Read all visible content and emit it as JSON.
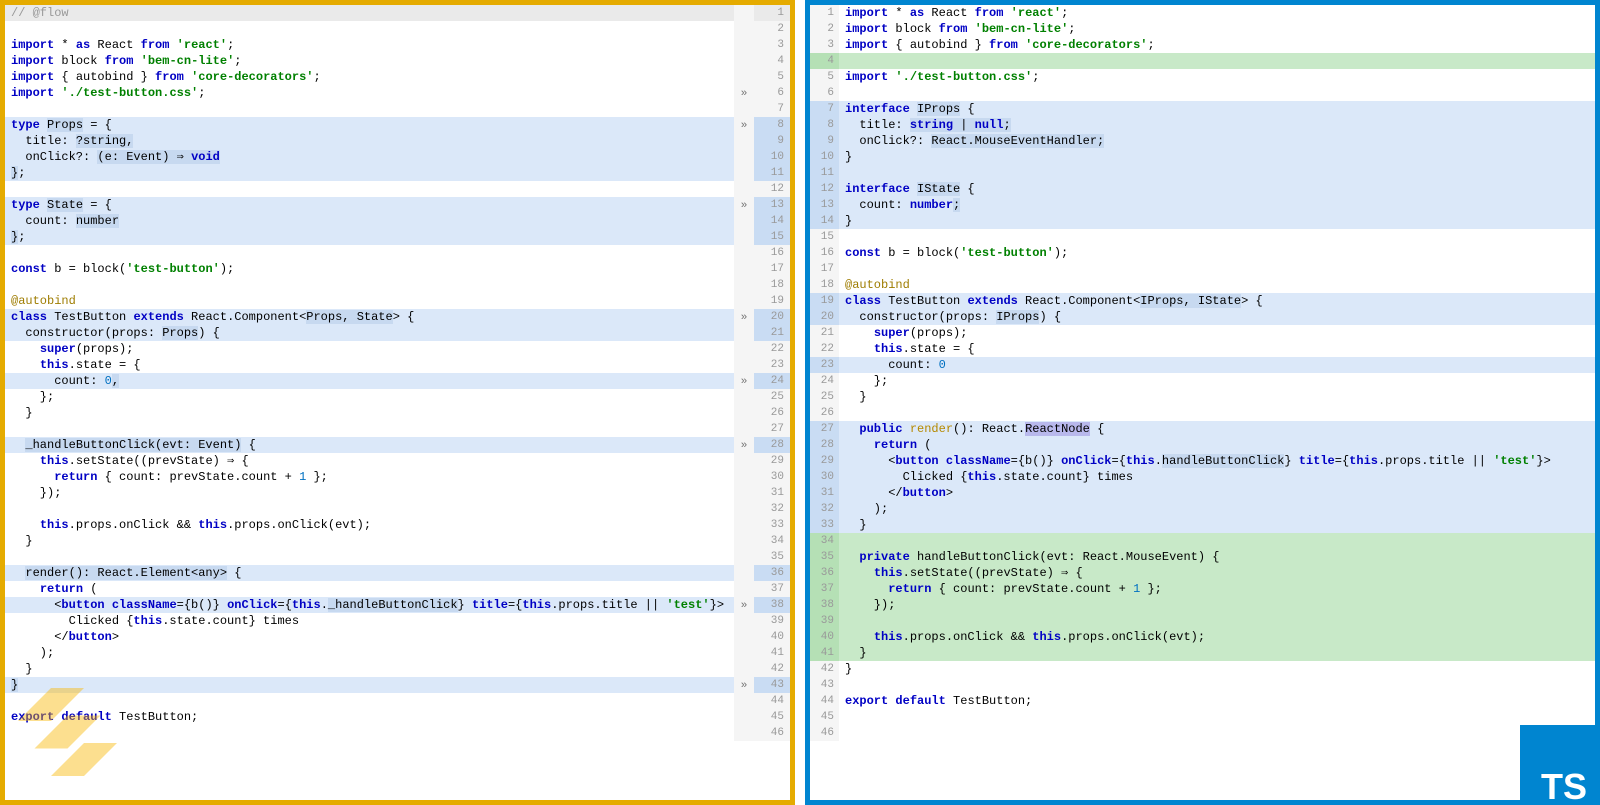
{
  "left": {
    "label": "flow",
    "border_color": "#e5ab00",
    "lines": [
      {
        "n": 1,
        "cls": "header",
        "html": "<span class='cmt'>// @flow</span>",
        "fold": ""
      },
      {
        "n": 2,
        "cls": "",
        "html": "",
        "fold": ""
      },
      {
        "n": 3,
        "cls": "",
        "html": "<span class='kw'>import</span> * <span class='kw'>as</span> React <span class='kw'>from</span> <span class='str'>'react'</span>;",
        "fold": ""
      },
      {
        "n": 4,
        "cls": "",
        "html": "<span class='kw'>import</span> block <span class='kw'>from</span> <span class='str'>'bem-cn-lite'</span>;",
        "fold": ""
      },
      {
        "n": 5,
        "cls": "",
        "html": "<span class='kw'>import</span> { autobind } <span class='kw'>from</span> <span class='str'>'core-decorators'</span>;",
        "fold": ""
      },
      {
        "n": 6,
        "cls": "",
        "html": "<span class='kw'>import</span> <span class='str'>'./test-button.css'</span>;",
        "fold": "»"
      },
      {
        "n": 7,
        "cls": "",
        "html": "",
        "fold": ""
      },
      {
        "n": 8,
        "cls": "blue",
        "html": "<span class='kw'>type</span> <span class='hlspan'>Props</span> = {",
        "fold": "»"
      },
      {
        "n": 9,
        "cls": "blue",
        "html": "  title: <span class='hlspan'>?string,</span>",
        "fold": ""
      },
      {
        "n": 10,
        "cls": "blue",
        "html": "  onClick?: <span class='hlspan'>(e: Event) ⇒ <span class='kw'>void</span></span>",
        "fold": ""
      },
      {
        "n": 11,
        "cls": "blue",
        "html": "<span class='hlspan'>}</span>;",
        "fold": ""
      },
      {
        "n": 12,
        "cls": "",
        "html": "",
        "fold": ""
      },
      {
        "n": 13,
        "cls": "blue",
        "html": "<span class='kw'>type</span> <span class='hlspan'>State</span> = {",
        "fold": "»"
      },
      {
        "n": 14,
        "cls": "blue",
        "html": "  count: <span class='hlspan'>number</span>",
        "fold": ""
      },
      {
        "n": 15,
        "cls": "blue",
        "html": "<span class='hlspan'>}</span>;",
        "fold": ""
      },
      {
        "n": 16,
        "cls": "",
        "html": "",
        "fold": ""
      },
      {
        "n": 17,
        "cls": "",
        "html": "<span class='kw'>const</span> b = block(<span class='str'>'test-button'</span>);",
        "fold": ""
      },
      {
        "n": 18,
        "cls": "",
        "html": "",
        "fold": ""
      },
      {
        "n": 19,
        "cls": "",
        "html": "<span class='ann'>@autobind</span>",
        "fold": ""
      },
      {
        "n": 20,
        "cls": "blue",
        "html": "<span class='kw'>class</span> TestButton <span class='kw'>extends</span> React.Component&lt;<span class='hlspan'>Props, State</span>&gt; {",
        "fold": "»"
      },
      {
        "n": 21,
        "cls": "blue",
        "html": "  constructor(props: <span class='hlspan'>Props</span>) {",
        "fold": ""
      },
      {
        "n": 22,
        "cls": "",
        "html": "    <span class='kw'>super</span>(props);",
        "fold": ""
      },
      {
        "n": 23,
        "cls": "",
        "html": "    <span class='kw'>this</span>.state = {",
        "fold": ""
      },
      {
        "n": 24,
        "cls": "blue",
        "html": "      count: <span class='num'>0</span><span class='hlspan'>,</span>",
        "fold": "»"
      },
      {
        "n": 25,
        "cls": "",
        "html": "    };",
        "fold": ""
      },
      {
        "n": 26,
        "cls": "",
        "html": "  }",
        "fold": ""
      },
      {
        "n": 27,
        "cls": "",
        "html": "",
        "fold": ""
      },
      {
        "n": 28,
        "cls": "blue",
        "html": "  <span class='hlspan'>_handleButtonClick(evt: Event)</span> {",
        "fold": "»"
      },
      {
        "n": 29,
        "cls": "",
        "html": "    <span class='kw'>this</span>.setState((prevState) ⇒ {",
        "fold": ""
      },
      {
        "n": 30,
        "cls": "",
        "html": "      <span class='kw'>return</span> { count: prevState.count + <span class='num'>1</span> };",
        "fold": ""
      },
      {
        "n": 31,
        "cls": "",
        "html": "    });",
        "fold": ""
      },
      {
        "n": 32,
        "cls": "",
        "html": "",
        "fold": ""
      },
      {
        "n": 33,
        "cls": "",
        "html": "    <span class='kw'>this</span>.props.onClick &amp;&amp; <span class='kw'>this</span>.props.onClick(evt);",
        "fold": ""
      },
      {
        "n": 34,
        "cls": "",
        "html": "  }",
        "fold": ""
      },
      {
        "n": 35,
        "cls": "",
        "html": "",
        "fold": ""
      },
      {
        "n": 36,
        "cls": "blue",
        "html": "  <span class='hlspan'>render(): React.Element&lt;any&gt;</span> {",
        "fold": ""
      },
      {
        "n": 37,
        "cls": "",
        "html": "    <span class='kw'>return</span> (",
        "fold": ""
      },
      {
        "n": 38,
        "cls": "blue",
        "html": "      &lt;<span class='kw'>button</span> <span class='kw'>className</span>={b()} <span class='kw'>onClick</span>={<span class='kw'>this</span>.<span class='hlspan'>_handleButtonClick</span>} <span class='kw'>title</span>={<span class='kw'>this</span>.props.title || <span class='str'>'test'</span>}&gt;",
        "fold": "»"
      },
      {
        "n": 39,
        "cls": "",
        "html": "        Clicked {<span class='kw'>this</span>.state.count} times",
        "fold": ""
      },
      {
        "n": 40,
        "cls": "",
        "html": "      &lt;/<span class='kw'>button</span>&gt;",
        "fold": ""
      },
      {
        "n": 41,
        "cls": "",
        "html": "    );",
        "fold": ""
      },
      {
        "n": 42,
        "cls": "",
        "html": "  }",
        "fold": ""
      },
      {
        "n": 43,
        "cls": "blue",
        "html": "<span class='hlspan'>}</span>",
        "fold": "»"
      },
      {
        "n": 44,
        "cls": "",
        "html": "",
        "fold": ""
      },
      {
        "n": 45,
        "cls": "",
        "html": "<span class='kw'>export</span> <span class='kw'>default</span> TestButton;",
        "fold": ""
      },
      {
        "n": 46,
        "cls": "",
        "html": "",
        "fold": ""
      }
    ]
  },
  "right": {
    "label": "typescript",
    "border_color": "#0085d0",
    "ts_logo": "TS",
    "lines": [
      {
        "n": 1,
        "cls": "",
        "html": "<span class='kw'>import</span> * <span class='kw'>as</span> React <span class='kw'>from</span> <span class='str'>'react'</span>;"
      },
      {
        "n": 2,
        "cls": "",
        "html": "<span class='kw'>import</span> block <span class='kw'>from</span> <span class='str'>'bem-cn-lite'</span>;"
      },
      {
        "n": 3,
        "cls": "",
        "html": "<span class='kw'>import</span> { autobind } <span class='kw'>from</span> <span class='str'>'core-decorators'</span>;"
      },
      {
        "n": 4,
        "cls": "green",
        "html": ""
      },
      {
        "n": 5,
        "cls": "",
        "html": "<span class='kw'>import</span> <span class='str'>'./test-button.css'</span>;"
      },
      {
        "n": 6,
        "cls": "",
        "html": ""
      },
      {
        "n": 7,
        "cls": "blue",
        "html": "<span class='kw'>interface</span> <span class='hlspan'>IProps</span> {"
      },
      {
        "n": 8,
        "cls": "blue",
        "html": "  title: <span class='hlspan'><span class='kw'>string</span> | <span class='kw'>null</span>;</span>"
      },
      {
        "n": 9,
        "cls": "blue",
        "html": "  onClick?: <span class='hlspan'>React.MouseEventHandler;</span>"
      },
      {
        "n": 10,
        "cls": "blue",
        "html": "}"
      },
      {
        "n": 11,
        "cls": "blue",
        "html": ""
      },
      {
        "n": 12,
        "cls": "blue",
        "html": "<span class='kw'>interface</span> <span class='hlspan'>IState</span> {"
      },
      {
        "n": 13,
        "cls": "blue",
        "html": "  count: <span class='kw'>number</span><span class='hlspan'>;</span>"
      },
      {
        "n": 14,
        "cls": "blue",
        "html": "}"
      },
      {
        "n": 15,
        "cls": "",
        "html": ""
      },
      {
        "n": 16,
        "cls": "",
        "html": "<span class='kw'>const</span> b = block(<span class='str'>'test-button'</span>);"
      },
      {
        "n": 17,
        "cls": "",
        "html": ""
      },
      {
        "n": 18,
        "cls": "",
        "html": "<span class='ann'>@autobind</span>"
      },
      {
        "n": 19,
        "cls": "blue",
        "html": "<span class='kw'>class</span> TestButton <span class='kw'>extends</span> React.Component&lt;<span class='hlspan'>IProps, IState</span>&gt; {"
      },
      {
        "n": 20,
        "cls": "blue",
        "html": "  constructor(props: <span class='hlspan'>IProps</span>) {"
      },
      {
        "n": 21,
        "cls": "",
        "html": "    <span class='kw'>super</span>(props);"
      },
      {
        "n": 22,
        "cls": "",
        "html": "    <span class='kw'>this</span>.state = {"
      },
      {
        "n": 23,
        "cls": "blue",
        "html": "      count: <span class='num'>0</span>"
      },
      {
        "n": 24,
        "cls": "",
        "html": "    };"
      },
      {
        "n": 25,
        "cls": "",
        "html": "  }"
      },
      {
        "n": 26,
        "cls": "",
        "html": ""
      },
      {
        "n": 27,
        "cls": "blue",
        "html": "  <span class='kw'>public</span> <span class='yspan'>render</span>(): React.<span class='hi-word'>ReactNode</span> {"
      },
      {
        "n": 28,
        "cls": "blue",
        "html": "    <span class='kw'>return</span> ("
      },
      {
        "n": 29,
        "cls": "blue",
        "html": "      &lt;<span class='kw'>button</span> <span class='kw'>className</span>={b()} <span class='kw'>onClick</span>={<span class='kw'>this</span>.<span class='hlspan'>handleButtonClick</span>} <span class='kw'>title</span>={<span class='kw'>this</span>.props.title || <span class='str'>'test'</span>}&gt;"
      },
      {
        "n": 30,
        "cls": "blue",
        "html": "        Clicked {<span class='kw'>this</span>.state.count} times"
      },
      {
        "n": 31,
        "cls": "blue",
        "html": "      &lt;/<span class='kw'>button</span>&gt;"
      },
      {
        "n": 32,
        "cls": "blue",
        "html": "    );"
      },
      {
        "n": 33,
        "cls": "blue",
        "html": "  }"
      },
      {
        "n": 34,
        "cls": "green",
        "html": ""
      },
      {
        "n": 35,
        "cls": "green",
        "html": "  <span class='kw'>private</span> handleButtonClick(evt: React.MouseEvent) {"
      },
      {
        "n": 36,
        "cls": "green",
        "html": "    <span class='kw'>this</span>.setState((prevState) ⇒ {"
      },
      {
        "n": 37,
        "cls": "green",
        "html": "      <span class='kw'>return</span> { count: prevState.count + <span class='num'>1</span> };"
      },
      {
        "n": 38,
        "cls": "green",
        "html": "    });"
      },
      {
        "n": 39,
        "cls": "green",
        "html": ""
      },
      {
        "n": 40,
        "cls": "green",
        "html": "    <span class='kw'>this</span>.props.onClick &amp;&amp; <span class='kw'>this</span>.props.onClick(evt);"
      },
      {
        "n": 41,
        "cls": "green",
        "html": "  }"
      },
      {
        "n": 42,
        "cls": "",
        "html": "}"
      },
      {
        "n": 43,
        "cls": "",
        "html": ""
      },
      {
        "n": 44,
        "cls": "",
        "html": "<span class='kw'>export</span> <span class='kw'>default</span> TestButton;"
      },
      {
        "n": 45,
        "cls": "",
        "html": ""
      },
      {
        "n": 46,
        "cls": "",
        "html": ""
      }
    ]
  }
}
